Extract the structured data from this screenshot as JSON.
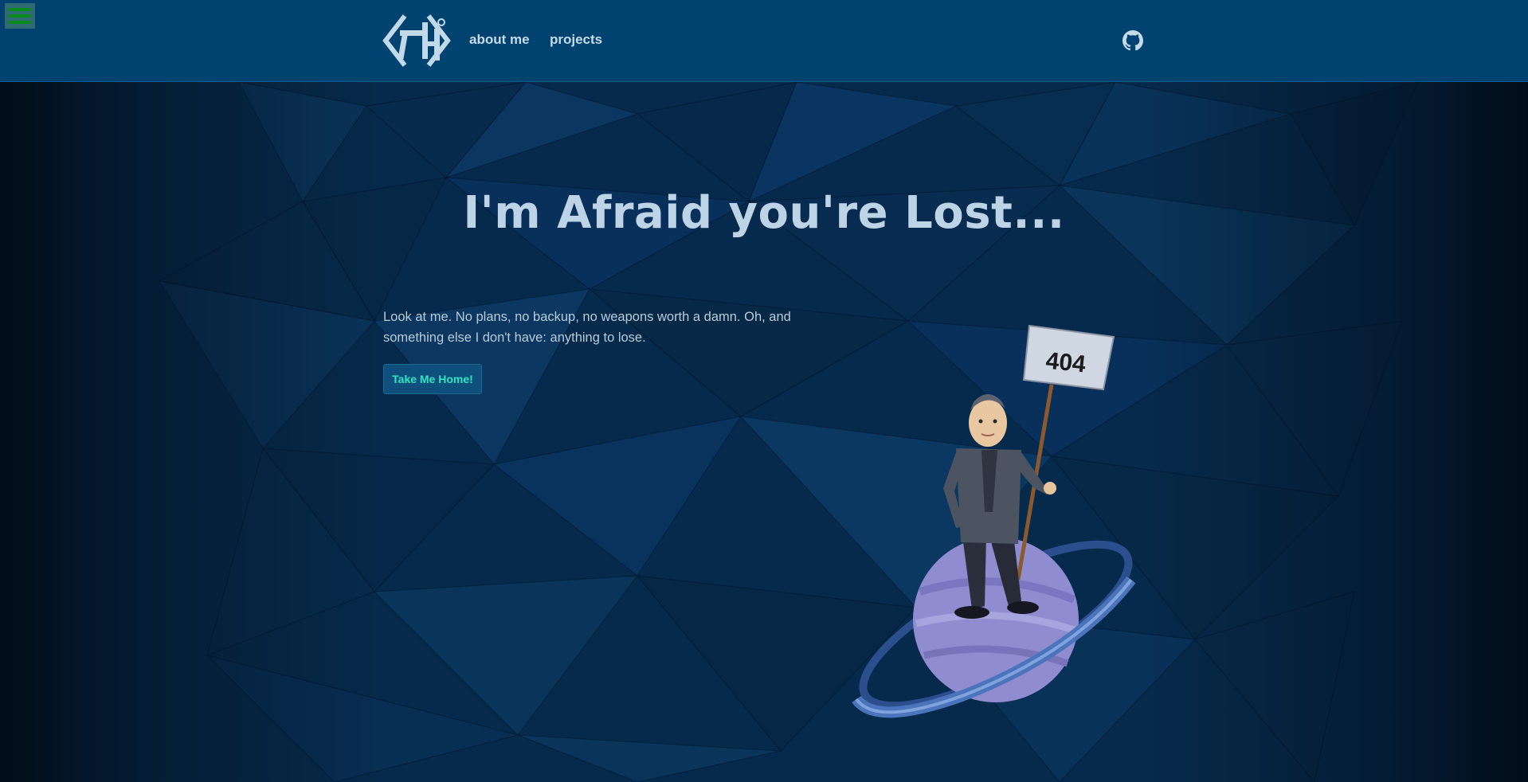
{
  "nav": {
    "menu_icon": "hamburger-menu-icon",
    "logo_icon": "th-monogram-logo",
    "links": [
      {
        "label": "about me"
      },
      {
        "label": "projects"
      }
    ],
    "github_icon": "github-icon"
  },
  "hero": {
    "headline": "I'm Afraid you're Lost...",
    "body": "Look at me. No plans, no backup, no weapons worth a damn. Oh, and something else I don't have: anything to lose.",
    "button_label": "Take Me Home!",
    "sign_text": "404"
  },
  "colors": {
    "navbar": "#004370",
    "hero_background": "#062a4b",
    "headline": "#bcd4e5",
    "button_text": "#2ee6c2",
    "menu_bars": "#0b8a1e"
  }
}
